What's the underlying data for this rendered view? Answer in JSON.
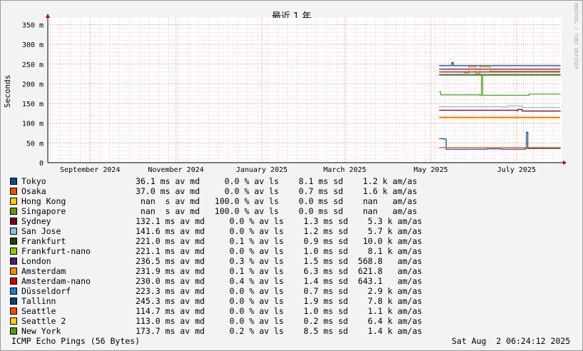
{
  "chart_data": {
    "type": "line",
    "title": "最近 1 年",
    "ylabel": "Seconds",
    "watermark": "RRDTOOL / TOBI OETIKER",
    "ylim": [
      0,
      0.36
    ],
    "y_ticks": [
      {
        "value": 0,
        "label": "0"
      },
      {
        "value": 0.05,
        "label": "50 m"
      },
      {
        "value": 0.1,
        "label": "100 m"
      },
      {
        "value": 0.15,
        "label": "150 m"
      },
      {
        "value": 0.2,
        "label": "200 m"
      },
      {
        "value": 0.25,
        "label": "250 m"
      },
      {
        "value": 0.3,
        "label": "300 m"
      },
      {
        "value": 0.35,
        "label": "350 m"
      }
    ],
    "xlim": [
      "2024-08-02",
      "2025-08-02"
    ],
    "x_ticks": [
      {
        "date": "2024-09-01",
        "label": "September 2024"
      },
      {
        "date": "2024-11-01",
        "label": "November 2024"
      },
      {
        "date": "2025-01-01",
        "label": "January 2025"
      },
      {
        "date": "2025-03-01",
        "label": "March 2025"
      },
      {
        "date": "2025-05-01",
        "label": "May 2025"
      },
      {
        "date": "2025-07-01",
        "label": "July 2025"
      }
    ],
    "grid": true,
    "series": [
      {
        "name": "Tokyo",
        "color": "#0a4a8a",
        "stats": "36.1 ms av md     0.0 % av ls    8.1 ms sd    1.2 k am/as",
        "points": [
          [
            "2025-05-07",
            0.061
          ],
          [
            "2025-05-10",
            0.06
          ],
          [
            "2025-05-12",
            0.034
          ],
          [
            "2025-06-10",
            0.035
          ],
          [
            "2025-06-20",
            0.034
          ],
          [
            "2025-07-07",
            0.035
          ],
          [
            "2025-07-08",
            0.077
          ],
          [
            "2025-07-09",
            0.036
          ],
          [
            "2025-08-01",
            0.035
          ]
        ]
      },
      {
        "name": "Osaka",
        "color": "#ff4a00",
        "stats": "37.0 ms av md     0.0 % av ls    0.7 ms sd    1.6 k am/as",
        "points": [
          [
            "2025-05-07",
            0.038
          ],
          [
            "2025-08-01",
            0.037
          ]
        ]
      },
      {
        "name": "Hong Kong",
        "color": "#ffcc00",
        "stats": " nan  s av md   100.0 % av ls    0.0 ms sd    nan   am/as",
        "points": []
      },
      {
        "name": "Singapore",
        "color": "#5c9e00",
        "stats": " nan  s av md   100.0 % av ls    0.0 ms sd    nan   am/as",
        "points": []
      },
      {
        "name": "Sydney",
        "color": "#7a0020",
        "stats": "132.1 ms av md     0.0 % av ls    1.3 ms sd    5.3 k am/as",
        "points": [
          [
            "2025-05-07",
            0.133
          ],
          [
            "2025-07-01",
            0.132
          ],
          [
            "2025-07-02",
            0.135
          ],
          [
            "2025-07-05",
            0.131
          ],
          [
            "2025-08-01",
            0.132
          ]
        ]
      },
      {
        "name": "San Jose",
        "color": "#86c0ea",
        "stats": "141.6 ms av md     0.0 % av ls    1.2 ms sd    5.7 k am/as",
        "points": [
          [
            "2025-05-07",
            0.142
          ],
          [
            "2025-06-20",
            0.141
          ],
          [
            "2025-06-25",
            0.144
          ],
          [
            "2025-07-05",
            0.14
          ],
          [
            "2025-08-01",
            0.141
          ]
        ]
      },
      {
        "name": "Frankfurt",
        "color": "#2a3a10",
        "stats": "221.0 ms av md     0.1 % av ls    0.9 ms sd   10.0 k am/as",
        "points": [
          [
            "2025-05-07",
            0.222
          ],
          [
            "2025-08-01",
            0.221
          ]
        ]
      },
      {
        "name": "Frankfurt-nano",
        "color": "#8cc800",
        "stats": "221.1 ms av md     0.0 % av ls    1.0 ms sd    8.1 k am/as",
        "points": [
          [
            "2025-05-07",
            0.221
          ],
          [
            "2025-08-01",
            0.221
          ]
        ]
      },
      {
        "name": "London",
        "color": "#4a1a7a",
        "stats": "236.5 ms av md     0.3 % av ls    1.5 ms sd  568.8   am/as",
        "points": [
          [
            "2025-05-07",
            0.237
          ],
          [
            "2025-08-01",
            0.236
          ]
        ]
      },
      {
        "name": "Amsterdam",
        "color": "#ff8c00",
        "stats": "231.9 ms av md     0.1 % av ls    6.3 ms sd  621.8   am/as",
        "points": [
          [
            "2025-05-10",
            0.23
          ],
          [
            "2025-05-25",
            0.228
          ],
          [
            "2025-05-28",
            0.243
          ],
          [
            "2025-06-02",
            0.226
          ],
          [
            "2025-06-05",
            0.243
          ],
          [
            "2025-06-12",
            0.232
          ],
          [
            "2025-08-01",
            0.232
          ]
        ]
      },
      {
        "name": "Amsterdam-nano",
        "color": "#cc0000",
        "stats": "230.0 ms av md     0.4 % av ls    1.4 ms sd  643.1   am/as",
        "points": [
          [
            "2025-05-07",
            0.23
          ],
          [
            "2025-08-01",
            0.23
          ]
        ]
      },
      {
        "name": "Düsseldorf",
        "color": "#1a7ec8",
        "stats": "223.3 ms av md     0.0 % av ls    0.7 ms sd    2.9 k am/as",
        "points": [
          [
            "2025-05-07",
            0.224
          ],
          [
            "2025-08-01",
            0.223
          ]
        ]
      },
      {
        "name": "Tallinn",
        "color": "#0a3f7a",
        "stats": "245.3 ms av md     0.0 % av ls    1.9 ms sd    7.8 k am/as",
        "points": [
          [
            "2025-05-07",
            0.246
          ],
          [
            "2025-05-15",
            0.246
          ],
          [
            "2025-05-16",
            0.254
          ],
          [
            "2025-05-17",
            0.246
          ],
          [
            "2025-08-01",
            0.245
          ]
        ]
      },
      {
        "name": "Seattle",
        "color": "#ff4a00",
        "stats": "114.7 ms av md     0.0 % av ls    1.0 ms sd    1.1 k am/as",
        "points": [
          [
            "2025-05-07",
            0.115
          ],
          [
            "2025-08-01",
            0.115
          ]
        ]
      },
      {
        "name": "Seattle 2",
        "color": "#ffcc00",
        "stats": "113.0 ms av md     0.0 % av ls    0.2 ms sd    6.4 k am/as",
        "points": [
          [
            "2025-05-07",
            0.113
          ],
          [
            "2025-08-01",
            0.113
          ]
        ]
      },
      {
        "name": "New York",
        "color": "#4a9e1a",
        "stats": "173.7 ms av md     0.2 % av ls    8.5 ms sd    1.4 k am/as",
        "points": [
          [
            "2025-05-07",
            0.18
          ],
          [
            "2025-05-08",
            0.172
          ],
          [
            "2025-06-05",
            0.17
          ],
          [
            "2025-06-06",
            0.223
          ],
          [
            "2025-06-07",
            0.171
          ],
          [
            "2025-07-10",
            0.174
          ],
          [
            "2025-08-01",
            0.173
          ]
        ]
      }
    ]
  },
  "footer": {
    "left": "ICMP Echo Pings (56 Bytes)",
    "right": "Sat Aug  2 06:24:12 2025"
  }
}
